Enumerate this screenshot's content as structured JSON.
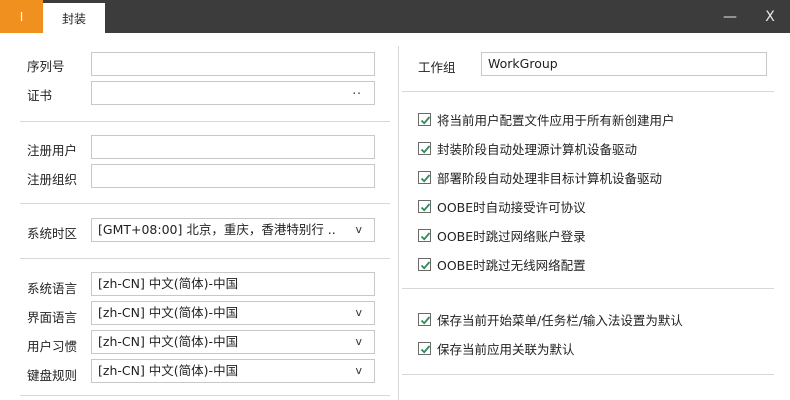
{
  "titlebar": {
    "app_icon": "I",
    "tab": "封装",
    "minimize": "—",
    "close": "X"
  },
  "left": {
    "serial": {
      "label": "序列号",
      "value": ""
    },
    "cert": {
      "label": "证书",
      "value": "",
      "browse": ".."
    },
    "reg_user": {
      "label": "注册用户",
      "value": ""
    },
    "reg_org": {
      "label": "注册组织",
      "value": ""
    },
    "timezone": {
      "label": "系统时区",
      "value": "[GMT+08:00] 北京，重庆，香港特别行 ..",
      "arrow": "v"
    },
    "sys_lang": {
      "label": "系统语言",
      "value": "[zh-CN] 中文(简体)-中国"
    },
    "ui_lang": {
      "label": "界面语言",
      "value": "[zh-CN] 中文(简体)-中国",
      "arrow": "v"
    },
    "locale": {
      "label": "用户习惯",
      "value": "[zh-CN] 中文(简体)-中国",
      "arrow": "v"
    },
    "keyboard": {
      "label": "键盘规则",
      "value": "[zh-CN] 中文(简体)-中国",
      "arrow": "v"
    }
  },
  "right": {
    "workgroup": {
      "label": "工作组",
      "value": "WorkGroup"
    },
    "options": [
      {
        "label": "将当前用户配置文件应用于所有新创建用户",
        "checked": true
      },
      {
        "label": "封装阶段自动处理源计算机设备驱动",
        "checked": true
      },
      {
        "label": "部署阶段自动处理非目标计算机设备驱动",
        "checked": true
      },
      {
        "label": "OOBE时自动接受许可协议",
        "checked": true
      },
      {
        "label": "OOBE时跳过网络账户登录",
        "checked": true
      },
      {
        "label": "OOBE时跳过无线网络配置",
        "checked": true
      }
    ],
    "options2": [
      {
        "label": "保存当前开始菜单/任务栏/输入法设置为默认",
        "checked": true
      },
      {
        "label": "保存当前应用关联为默认",
        "checked": true
      }
    ]
  },
  "colors": {
    "accent": "#f0901e",
    "titlebar": "#3c3c3c",
    "check": "#2e8b57"
  }
}
